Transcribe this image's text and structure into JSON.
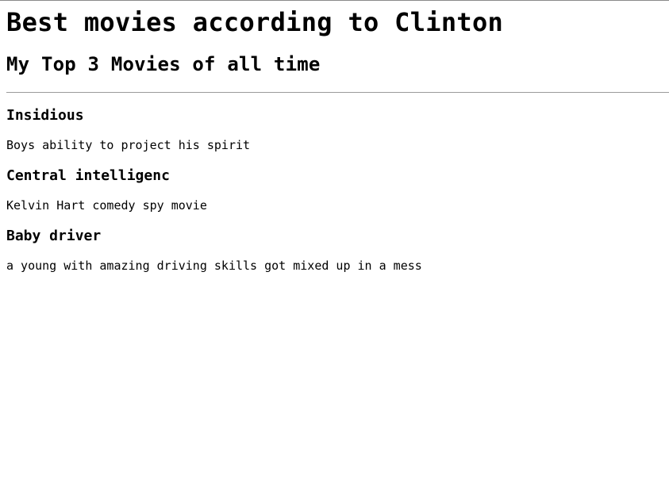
{
  "header": {
    "title": "Best movies according to Clinton",
    "subtitle": "My Top 3 Movies of all time"
  },
  "movies": [
    {
      "title": "Insidious",
      "description": "Boys ability to project his spirit"
    },
    {
      "title": "Central intelligenc",
      "description": "Kelvin Hart comedy spy movie"
    },
    {
      "title": "Baby driver",
      "description": "a young with amazing driving skills got mixed up in a mess"
    }
  ]
}
